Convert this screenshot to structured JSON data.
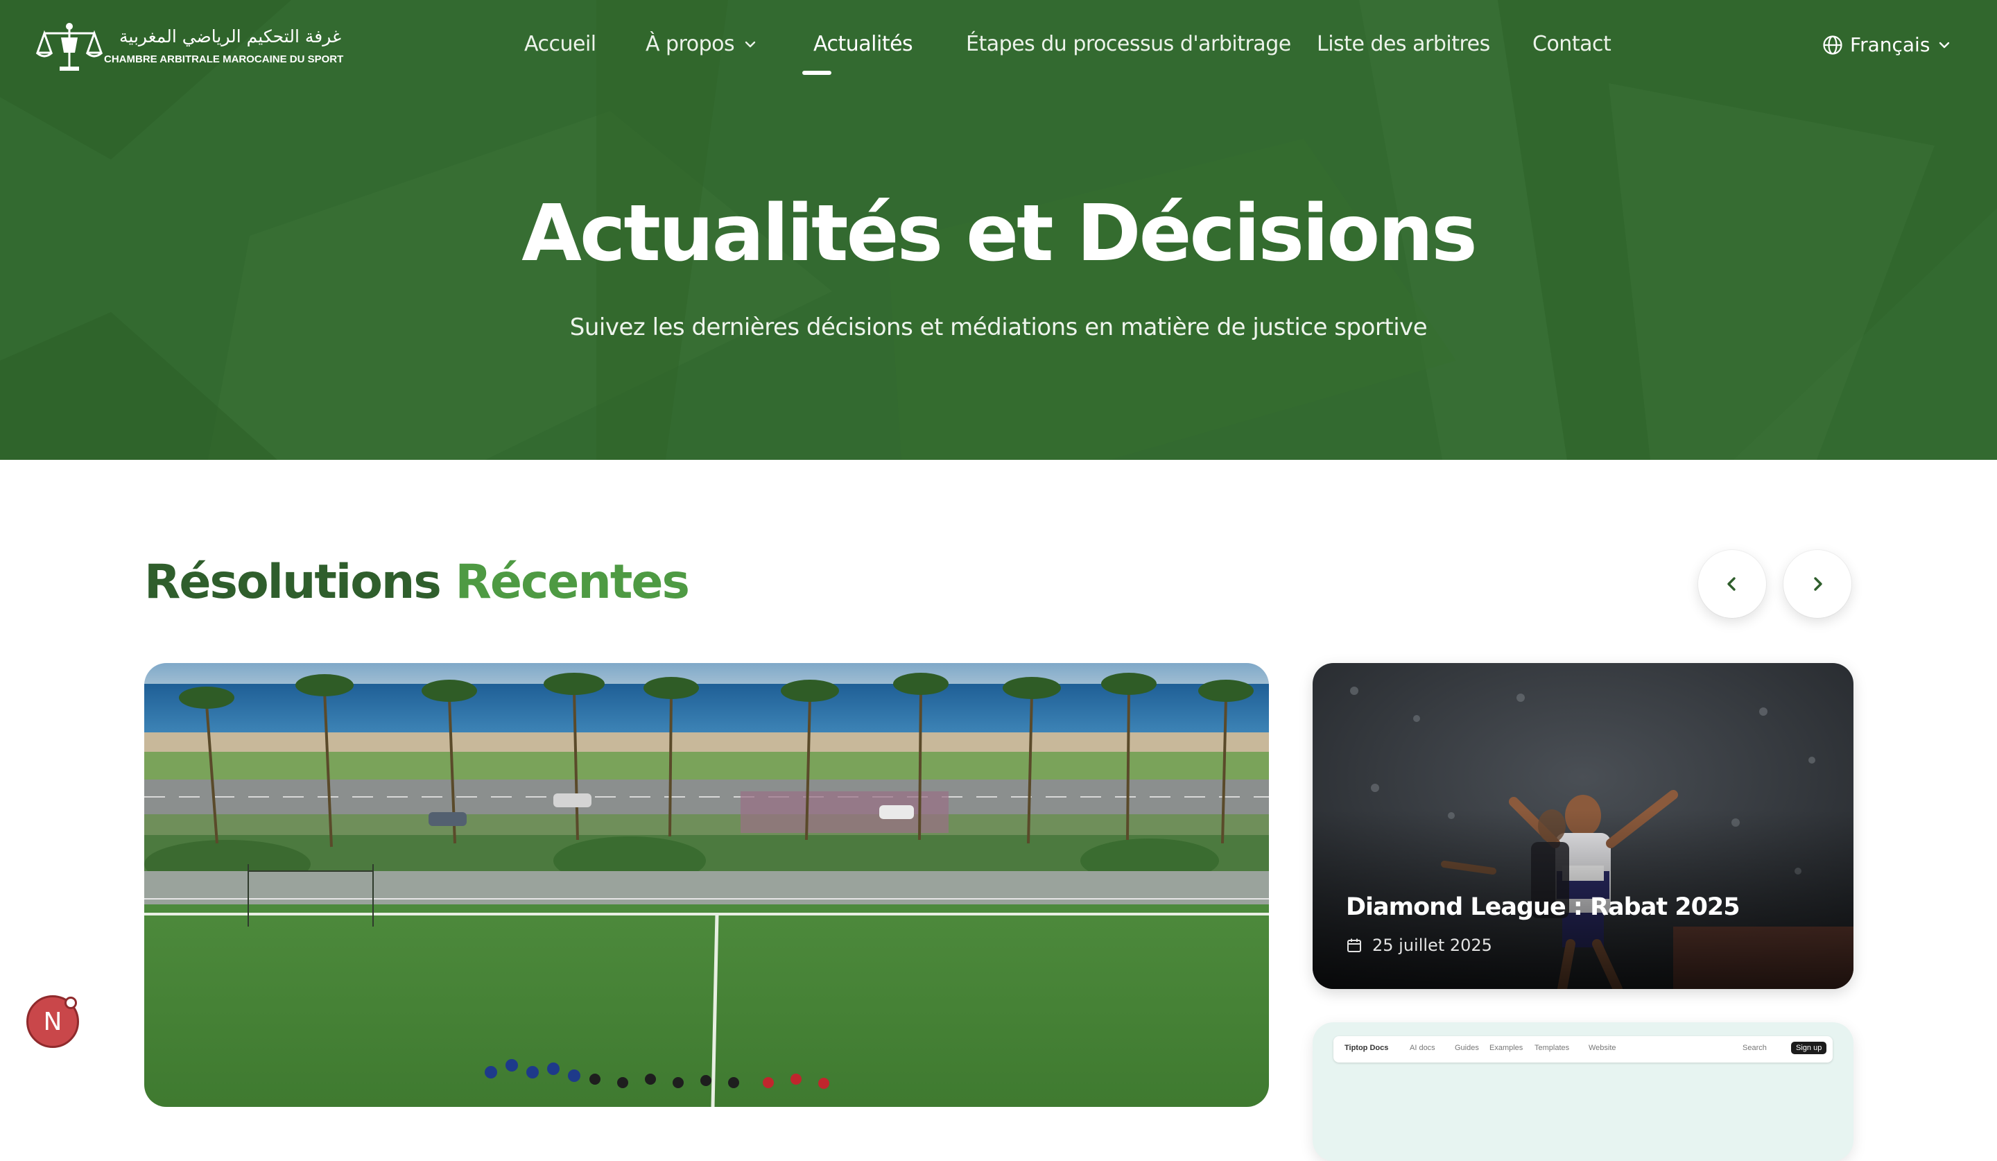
{
  "brand": {
    "arabic_name": "غرفة التحكيم الرياضي المغربية",
    "latin_name": "CHAMBRE ARBITRALE MAROCAINE DU SPORT"
  },
  "nav": {
    "items": [
      {
        "label": "Accueil"
      },
      {
        "label": "À propos"
      },
      {
        "label": "Actualités"
      },
      {
        "label": "Étapes du processus d'arbitrage"
      },
      {
        "label": "Liste des arbitres"
      },
      {
        "label": "Contact"
      }
    ],
    "active": "Actualités",
    "language": "Français"
  },
  "hero": {
    "title": "Actualités et Décisions",
    "subtitle": "Suivez les dernières décisions et médiations en matière de justice sportive"
  },
  "section": {
    "title_part1": "Résolutions",
    "title_part2": "Récentes"
  },
  "cards": [
    {
      "title": "",
      "date": ""
    },
    {
      "title": "Diamond League : Rabat 2025",
      "date": "25 juillet 2025"
    },
    {
      "title": "",
      "date": ""
    }
  ],
  "tiptop": {
    "brand": "Tiptop Docs",
    "links": [
      "AI docs",
      "Guides",
      "Examples",
      "Templates",
      "Website"
    ],
    "search": "Search",
    "signup": "Sign up"
  },
  "avatar": {
    "initial": "N"
  },
  "colors": {
    "hero_bg": "#336a30",
    "title_dark_green": "#2f5e2c",
    "title_light_green": "#4e9a43",
    "avatar_red": "#c9474a"
  },
  "icons": [
    "globe-icon",
    "chevron-down-icon",
    "chevron-left-icon",
    "chevron-right-icon",
    "calendar-icon",
    "balance-scale-icon"
  ]
}
